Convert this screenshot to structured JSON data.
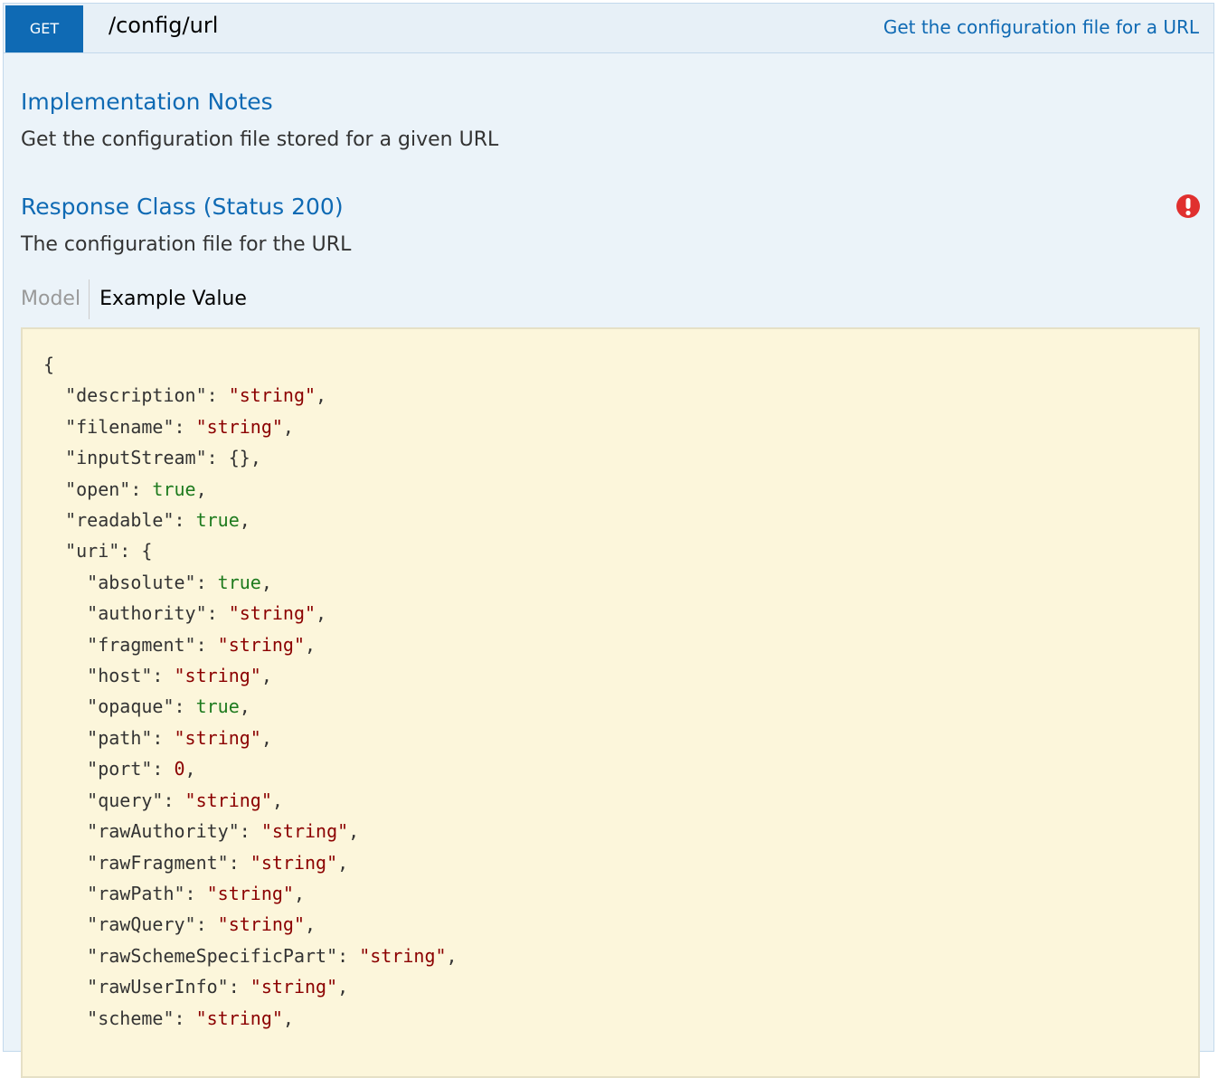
{
  "header": {
    "method": "GET",
    "path": "/config/url",
    "summary": "Get the configuration file for a URL"
  },
  "implementation_notes": {
    "title": "Implementation Notes",
    "text": "Get the configuration file stored for a given URL"
  },
  "response_class": {
    "title": "Response Class (Status 200)",
    "text": "The configuration file for the URL",
    "icon": "error-icon",
    "icon_color": "#e0302f"
  },
  "tabs": {
    "model": "Model",
    "example": "Example Value"
  },
  "example_json": [
    {
      "indent": 0,
      "open": "{"
    },
    {
      "indent": 1,
      "key": "description",
      "type": "string",
      "value": "\"string\"",
      "comma": ","
    },
    {
      "indent": 1,
      "key": "filename",
      "type": "string",
      "value": "\"string\"",
      "comma": ","
    },
    {
      "indent": 1,
      "key": "inputStream",
      "type": "plain",
      "value": "{}",
      "comma": ","
    },
    {
      "indent": 1,
      "key": "open",
      "type": "bool",
      "value": "true",
      "comma": ","
    },
    {
      "indent": 1,
      "key": "readable",
      "type": "bool",
      "value": "true",
      "comma": ","
    },
    {
      "indent": 1,
      "key": "uri",
      "type": "plain",
      "value": "{",
      "comma": ""
    },
    {
      "indent": 2,
      "key": "absolute",
      "type": "bool",
      "value": "true",
      "comma": ","
    },
    {
      "indent": 2,
      "key": "authority",
      "type": "string",
      "value": "\"string\"",
      "comma": ","
    },
    {
      "indent": 2,
      "key": "fragment",
      "type": "string",
      "value": "\"string\"",
      "comma": ","
    },
    {
      "indent": 2,
      "key": "host",
      "type": "string",
      "value": "\"string\"",
      "comma": ","
    },
    {
      "indent": 2,
      "key": "opaque",
      "type": "bool",
      "value": "true",
      "comma": ","
    },
    {
      "indent": 2,
      "key": "path",
      "type": "string",
      "value": "\"string\"",
      "comma": ","
    },
    {
      "indent": 2,
      "key": "port",
      "type": "number",
      "value": "0",
      "comma": ","
    },
    {
      "indent": 2,
      "key": "query",
      "type": "string",
      "value": "\"string\"",
      "comma": ","
    },
    {
      "indent": 2,
      "key": "rawAuthority",
      "type": "string",
      "value": "\"string\"",
      "comma": ","
    },
    {
      "indent": 2,
      "key": "rawFragment",
      "type": "string",
      "value": "\"string\"",
      "comma": ","
    },
    {
      "indent": 2,
      "key": "rawPath",
      "type": "string",
      "value": "\"string\"",
      "comma": ","
    },
    {
      "indent": 2,
      "key": "rawQuery",
      "type": "string",
      "value": "\"string\"",
      "comma": ","
    },
    {
      "indent": 2,
      "key": "rawSchemeSpecificPart",
      "type": "string",
      "value": "\"string\"",
      "comma": ","
    },
    {
      "indent": 2,
      "key": "rawUserInfo",
      "type": "string",
      "value": "\"string\"",
      "comma": ","
    },
    {
      "indent": 2,
      "key": "scheme",
      "type": "string",
      "value": "\"string\"",
      "comma": ","
    }
  ],
  "colors": {
    "accent": "#0f6ab4",
    "string_value": "#8b0000",
    "bool_value": "#1d7a1d",
    "code_background": "#fcf6db"
  }
}
